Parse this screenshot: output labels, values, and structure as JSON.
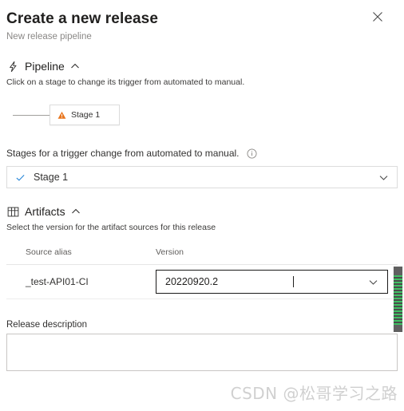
{
  "panel": {
    "title": "Create a new release",
    "subtitle": "New release pipeline",
    "close_icon": "close-icon"
  },
  "pipeline": {
    "icon": "lightning-bolt-icon",
    "label": "Pipeline",
    "collapse_icon": "chevron-up-icon",
    "description": "Click on a stage to change its trigger from automated to manual.",
    "stage_node": {
      "label": "Stage 1",
      "status_icon": "warning-triangle-icon",
      "status_color": "#e8761f"
    },
    "trigger_field": {
      "label": "Stages for a trigger change from automated to manual.",
      "info_icon": "info-circle-icon",
      "selected": "Stage 1",
      "selected_icon": "check-icon",
      "selected_icon_color": "#0078d4",
      "dropdown_icon": "chevron-down-icon",
      "options": [
        "Stage 1"
      ]
    }
  },
  "artifacts": {
    "icon": "artifacts-grid-icon",
    "label": "Artifacts",
    "collapse_icon": "chevron-up-icon",
    "description": "Select the version for the artifact sources for this release",
    "columns": [
      "Source alias",
      "Version"
    ],
    "rows": [
      {
        "source_alias": "_test-API01-CI",
        "version": "20220920.2",
        "dropdown_icon": "chevron-down-icon"
      }
    ]
  },
  "release_description": {
    "label": "Release description",
    "value": "",
    "placeholder": ""
  },
  "scrollbar": {
    "name": "vertical-scrollbar",
    "thumb_color": "#606060",
    "stripe_color": "#3fbf63"
  },
  "watermark": {
    "text": "CSDN @松哥学习之路"
  }
}
